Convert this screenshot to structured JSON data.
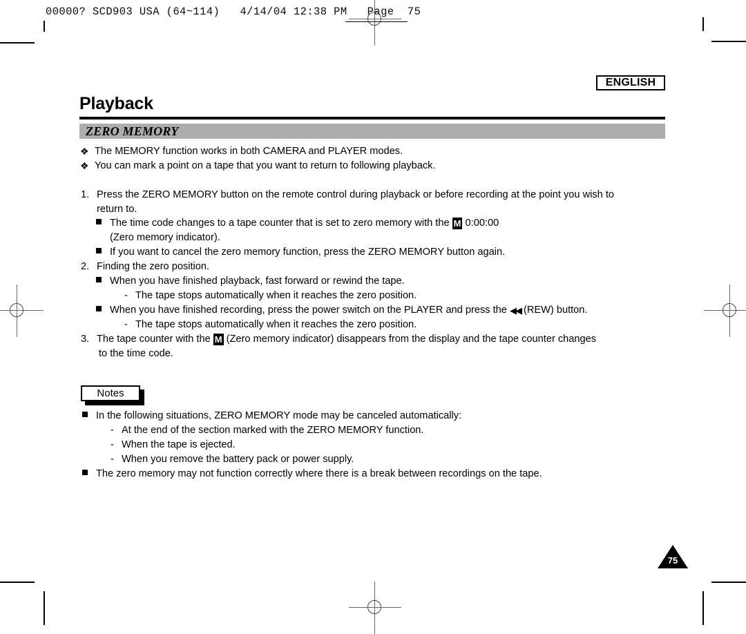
{
  "scan_slug": {
    "text": "00000? SCD903 USA (64~114)   4/14/04 12:38 PM   Page  75"
  },
  "header": {
    "language_badge": "ENGLISH",
    "title": "Playback",
    "section_title": "ZERO MEMORY"
  },
  "intro_bullets": [
    {
      "marker": "❖",
      "text": "The MEMORY function works in both CAMERA and PLAYER modes."
    },
    {
      "marker": "❖",
      "text": "You can mark a point on a tape that you want to return to following playback."
    }
  ],
  "steps": [
    {
      "number": "1.",
      "lines": [
        "Press the ZERO MEMORY button on the remote control during playback or before recording at the point you wish to",
        "return to."
      ],
      "subs": [
        {
          "marker": "square",
          "pre": "The time code changes to a tape counter that is set to zero memory with the",
          "indicator": "M",
          "post": "0:00:00",
          "second_line": "(Zero memory indicator)."
        },
        {
          "marker": "square",
          "pre": "If you want to cancel the zero memory function, press the ZERO MEMORY button again.",
          "indicator": "",
          "post": "",
          "second_line": ""
        }
      ]
    },
    {
      "number": "2.",
      "lines": [
        "Finding the zero position."
      ],
      "subs": [
        {
          "marker": "square",
          "pre": "When you have finished playback, fast forward or rewind the tape.",
          "indicator": "",
          "post": "",
          "second_line": ""
        },
        {
          "marker": "dash",
          "pre": "The tape stops automatically when it reaches the zero position.",
          "indicator": "",
          "post": "",
          "second_line": ""
        },
        {
          "marker": "square",
          "pre": "When you have finished recording, press the power switch on the PLAYER and press the",
          "indicator": "rew",
          "post": "(REW) button.",
          "second_line": ""
        },
        {
          "marker": "dash",
          "pre": "The tape stops automatically when it reaches the zero position.",
          "indicator": "",
          "post": "",
          "second_line": ""
        }
      ]
    },
    {
      "number": "3.",
      "lines": [],
      "subs": [],
      "inline_pre": "The tape counter with the",
      "inline_indicator": "M",
      "inline_post": "(Zero memory indicator) disappears from the display and the tape counter changes",
      "inline_second_line": "to the time code."
    }
  ],
  "notes": {
    "label": "Notes",
    "items": [
      {
        "marker": "square",
        "text": "In the following situations, ZERO MEMORY mode may be canceled automatically:"
      },
      {
        "marker": "dash",
        "text": "At the end of the section marked with the ZERO MEMORY function."
      },
      {
        "marker": "dash",
        "text": "When the tape is ejected."
      },
      {
        "marker": "dash",
        "text": "When you remove the battery pack or power supply."
      },
      {
        "marker": "square",
        "text": "The zero memory may not function correctly where there is a break between recordings on the tape."
      }
    ]
  },
  "footer": {
    "page_number": "75"
  },
  "icons": {
    "rewind": "◀◀",
    "dash": "-"
  },
  "colors": {
    "section_bar": "#adadad",
    "rule": "#000000",
    "page_background": "#ffffff"
  }
}
